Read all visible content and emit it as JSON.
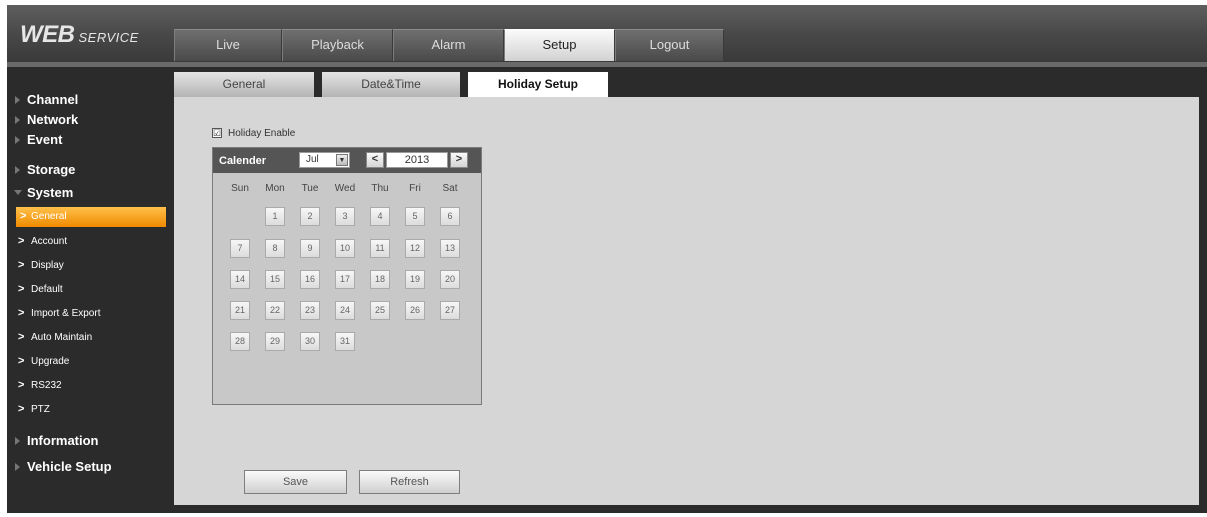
{
  "app": {
    "logo_main": "WEB",
    "logo_sub": "SERVICE"
  },
  "main_tabs": [
    "Live",
    "Playback",
    "Alarm",
    "Setup",
    "Logout"
  ],
  "active_main_tab": "Setup",
  "sidebar": {
    "items": [
      {
        "label": "Channel"
      },
      {
        "label": "Network"
      },
      {
        "label": "Event"
      },
      {
        "label": "Storage"
      },
      {
        "label": "System",
        "expanded": true
      },
      {
        "label": "Information"
      },
      {
        "label": "Vehicle Setup"
      }
    ],
    "system_sub": [
      "General",
      "Account",
      "Display",
      "Default",
      "Import & Export",
      "Auto Maintain",
      "Upgrade",
      "RS232",
      "PTZ"
    ],
    "active_sub": "General"
  },
  "sub_tabs": [
    "General",
    "Date&Time",
    "Holiday Setup"
  ],
  "active_sub_tab": "Holiday Setup",
  "holiday": {
    "enable_label": "Holiday Enable",
    "enable_checked": true,
    "check_mark": "☑"
  },
  "calendar": {
    "title": "Calender",
    "month": "Jul",
    "year": "2013",
    "prev": "<",
    "next": ">",
    "weekdays": [
      "Sun",
      "Mon",
      "Tue",
      "Wed",
      "Thu",
      "Fri",
      "Sat"
    ],
    "first_weekday_index": 1,
    "days_in_month": 31
  },
  "buttons": {
    "save": "Save",
    "refresh": "Refresh"
  },
  "colors": {
    "active_nav": "#f39200",
    "panel": "#d6d6d6",
    "chrome": "#2b2b2b"
  }
}
